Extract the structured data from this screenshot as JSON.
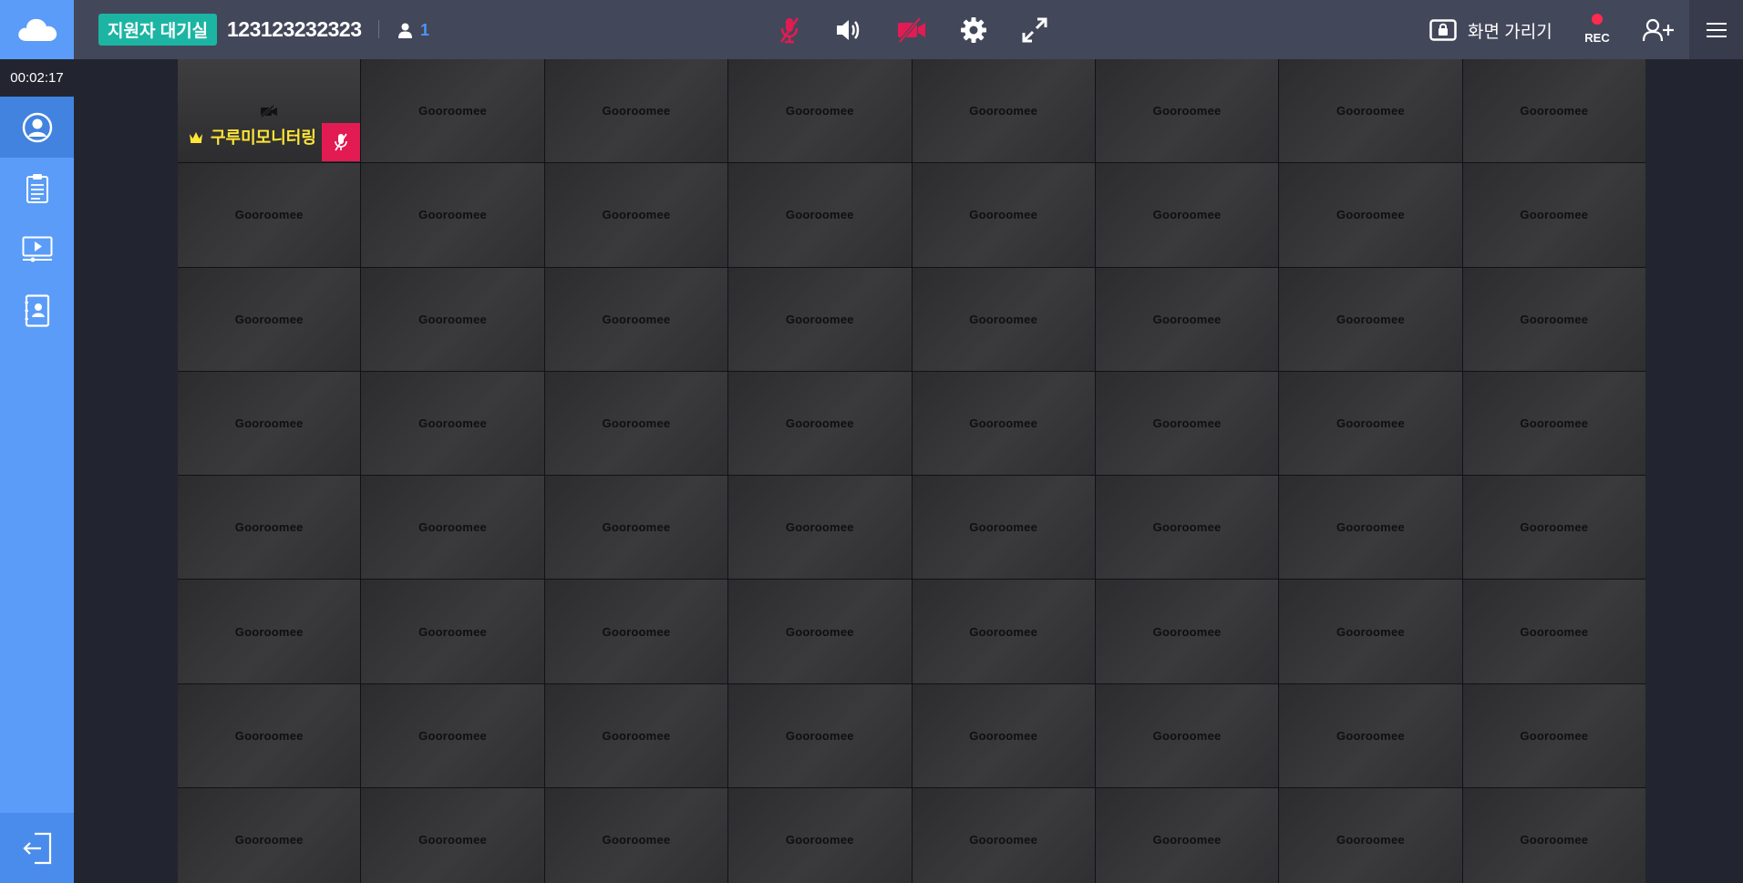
{
  "header": {
    "room_badge": "지원자 대기실",
    "room_id": "123123232323",
    "participant_count": "1",
    "hide_screen_label": "화면 가리기",
    "rec_label": "REC"
  },
  "sidebar": {
    "timer": "00:02:17",
    "items": [
      "profile-icon",
      "clipboard-icon",
      "screen-play-icon",
      "contact-card-icon"
    ]
  },
  "self_tile": {
    "name": "구루미모니터링"
  },
  "tiles": {
    "brand": "Gooroomee"
  },
  "colors": {
    "accent_blue": "#5a9cf8",
    "badge_teal": "#1cb5a3",
    "muted_red": "#e31b53",
    "rec_red": "#ff2a4f",
    "name_yellow": "#ffe637"
  }
}
